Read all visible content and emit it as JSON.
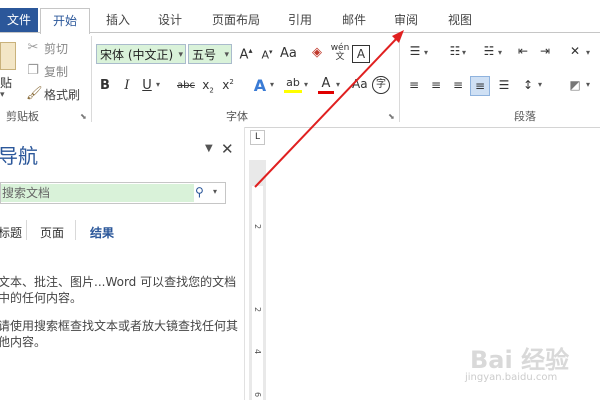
{
  "tabs": {
    "file": "文件",
    "home": "开始",
    "insert": "插入",
    "design": "设计",
    "layout": "页面布局",
    "references": "引用",
    "mailings": "邮件",
    "review": "审阅",
    "view": "视图"
  },
  "clipboard": {
    "paste": "贴",
    "cut": "剪切",
    "copy": "复制",
    "format_painter": "格式刷",
    "group_label": "剪贴板"
  },
  "font": {
    "font_name": "宋体 (中文正)",
    "font_size": "五号",
    "group_label": "字体"
  },
  "paragraph": {
    "group_label": "段落"
  },
  "nav": {
    "title": "导航",
    "search_placeholder": "搜索文档",
    "tab_headings": "标题",
    "tab_pages": "页面",
    "tab_results": "结果",
    "para1_line1": "文本、批注、图片...Word 可以查找您的文档",
    "para1_line2": "中的任何内容。",
    "para2_line1": "请使用搜索框查找文本或者放大镜查找任何其",
    "para2_line2": "他内容。"
  },
  "ruler": {
    "corner": "L",
    "numbers": [
      "2",
      "2",
      "4",
      "6"
    ]
  },
  "watermark": {
    "main": "Bai 经验",
    "sub": "jingyan.baidu.com"
  },
  "colors": {
    "accent": "#2b579a",
    "highlight": "#d9f2d9",
    "arrow": "#e02020"
  }
}
